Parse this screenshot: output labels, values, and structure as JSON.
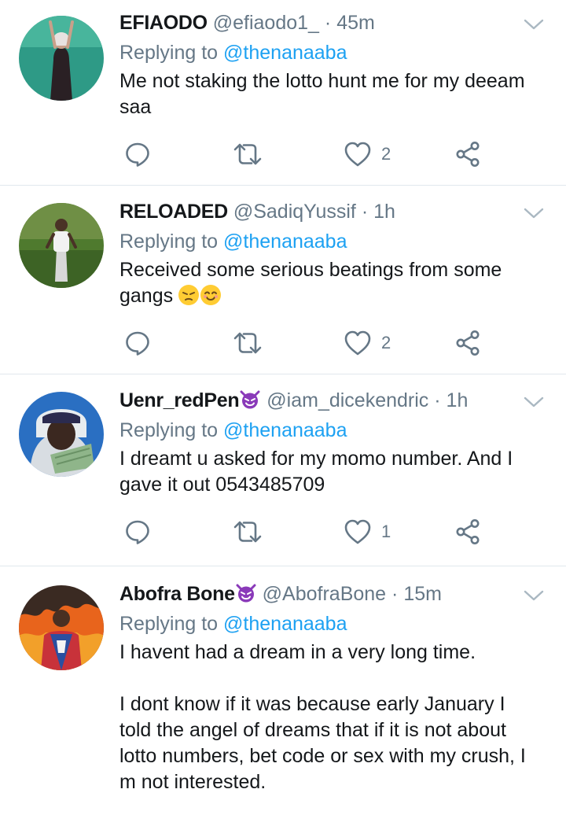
{
  "tweets": [
    {
      "name": "EFIAODO",
      "handle": "@efiaodo1_",
      "time": "45m",
      "replying_label": "Replying to",
      "replying_to": "@thenanaaba",
      "text": "Me not staking the lotto hunt me for my deeam saa",
      "likes": "2"
    },
    {
      "name": "RELOADED",
      "handle": "@SadiqYussif",
      "time": "1h",
      "replying_label": "Replying to",
      "replying_to": "@thenanaaba",
      "text": "Received some serious beatings from some gangs",
      "likes": "2"
    },
    {
      "name": "Uenr_redPen",
      "handle": "@iam_dicekendric",
      "time": "1h",
      "replying_label": "Replying to",
      "replying_to": "@thenanaaba",
      "text": "I dreamt u asked for my momo number. And I gave it out 0543485709",
      "likes": "1"
    },
    {
      "name": "Abofra Bone",
      "handle": "@AbofraBone",
      "time": "15m",
      "replying_label": "Replying to",
      "replying_to": "@thenanaaba",
      "text": "I havent had a dream in a very long time.\n\nI dont know if it was because early January I told the angel of dreams that if it is not about lotto numbers, bet code or sex with my crush, I m not interested."
    }
  ],
  "icons": {
    "reply": "reply-icon",
    "retweet": "retweet-icon",
    "like": "heart-icon",
    "share": "share-icon",
    "more": "chevron-down-icon"
  },
  "colors": {
    "link": "#1da1f2",
    "secondary": "#657786",
    "divider": "#e1e8ed"
  }
}
